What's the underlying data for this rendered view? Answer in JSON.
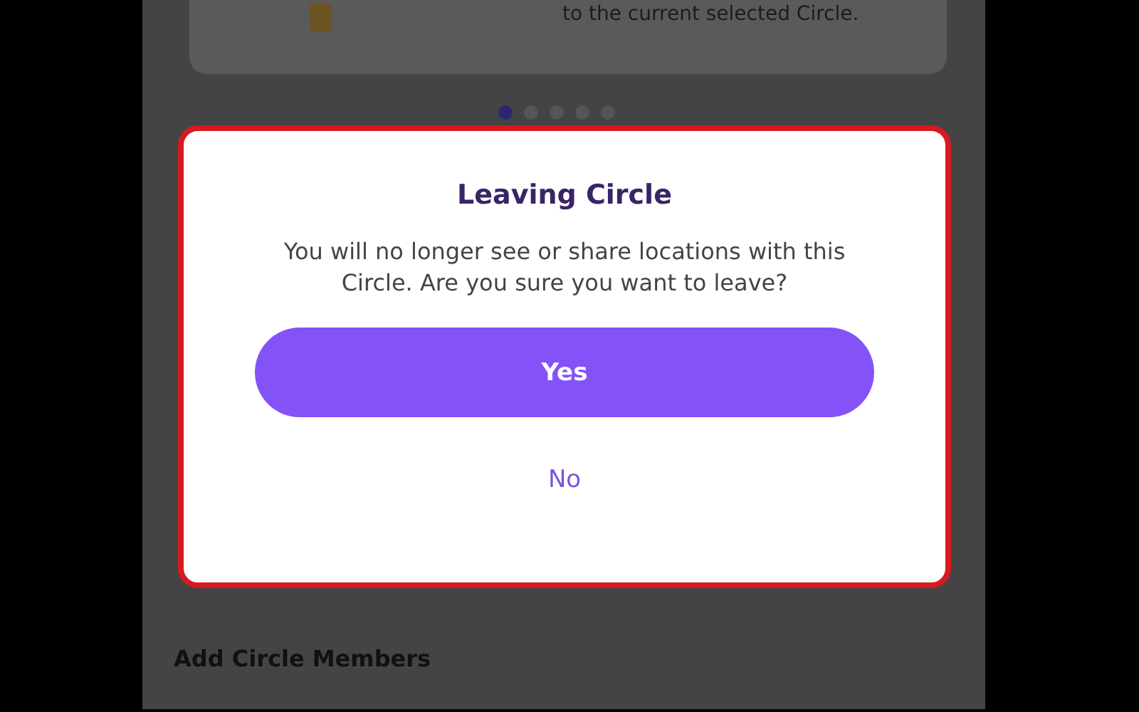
{
  "card": {
    "text": "to the current selected Circle."
  },
  "pager": [
    {
      "selected": true
    },
    {
      "selected": false
    },
    {
      "selected": false
    },
    {
      "selected": false
    },
    {
      "selected": false
    }
  ],
  "dialog": {
    "title": "Leaving Circle",
    "message": "You will no longer see or share locations with this Circle. Are you sure you want to leave?",
    "confirm": "Yes",
    "cancel": "No"
  },
  "section_title": "Add Circle Members"
}
